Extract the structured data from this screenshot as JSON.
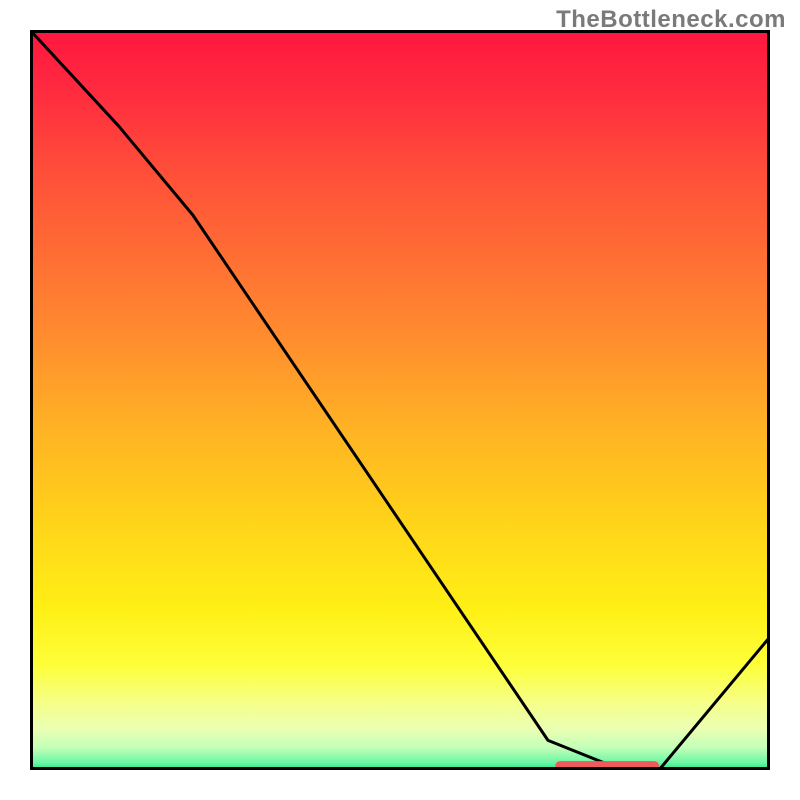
{
  "attribution": "TheBottleneck.com",
  "chart_data": {
    "type": "line",
    "title": "",
    "xlabel": "",
    "ylabel": "",
    "xlim": [
      0,
      100
    ],
    "ylim": [
      0,
      100
    ],
    "series": [
      {
        "name": "curve",
        "points": [
          {
            "x": 0,
            "y": 100
          },
          {
            "x": 12,
            "y": 87
          },
          {
            "x": 22,
            "y": 75
          },
          {
            "x": 70,
            "y": 4
          },
          {
            "x": 80,
            "y": 0
          },
          {
            "x": 85,
            "y": 0
          },
          {
            "x": 100,
            "y": 18
          }
        ]
      }
    ],
    "marker_segment": {
      "x_start": 71,
      "x_end": 85,
      "y": 0.6
    }
  }
}
